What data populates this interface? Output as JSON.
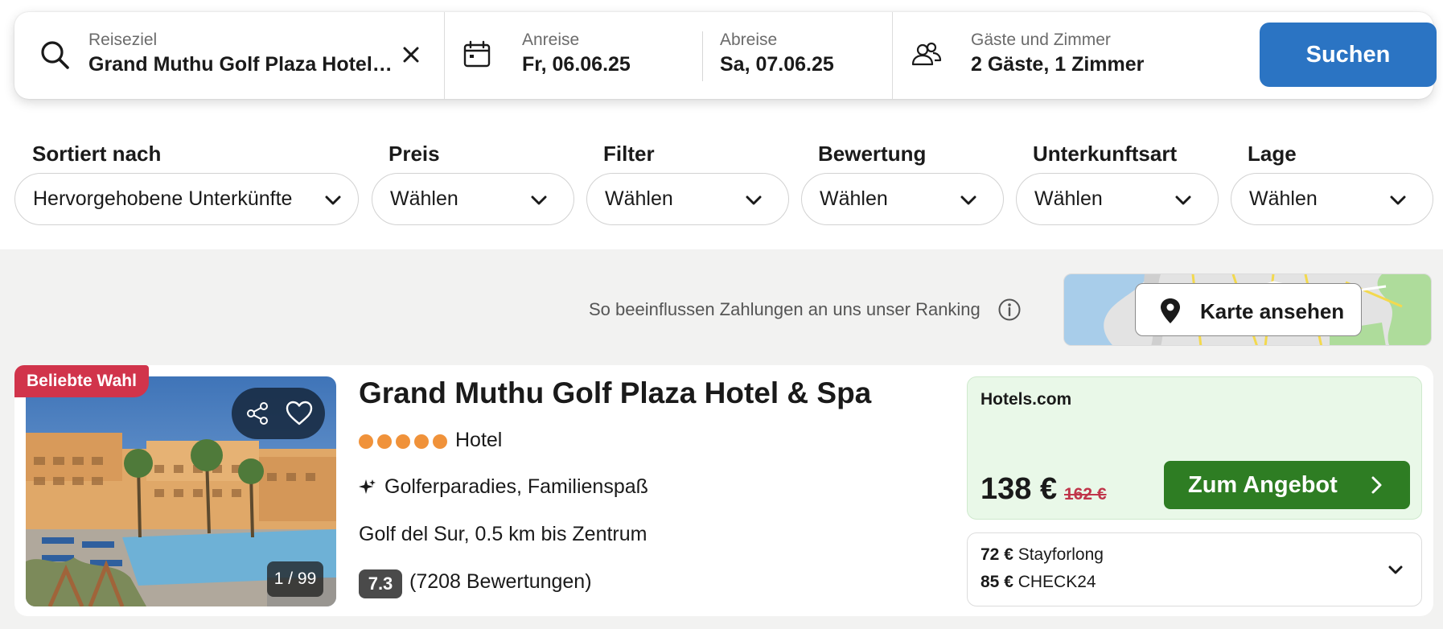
{
  "search": {
    "destination_label": "Reiseziel",
    "destination_value": "Grand Muthu Golf Plaza Hotel & Spa",
    "checkin_label": "Anreise",
    "checkin_value": "Fr, 06.06.25",
    "checkout_label": "Abreise",
    "checkout_value": "Sa, 07.06.25",
    "guests_label": "Gäste und Zimmer",
    "guests_value": "2 Gäste, 1 Zimmer",
    "search_button": "Suchen"
  },
  "filters": [
    {
      "label": "Sortiert nach",
      "value": "Hervorgehobene Unterkünfte"
    },
    {
      "label": "Preis",
      "value": "Wählen"
    },
    {
      "label": "Filter",
      "value": "Wählen"
    },
    {
      "label": "Bewertung",
      "value": "Wählen"
    },
    {
      "label": "Unterkunftsart",
      "value": "Wählen"
    },
    {
      "label": "Lage",
      "value": "Wählen"
    }
  ],
  "ranking_note": "So beeinflussen Zahlungen an uns unser Ranking",
  "map_button": "Karte ansehen",
  "result": {
    "badge": "Beliebte Wahl",
    "photo_counter": "1 / 99",
    "name": "Grand Muthu Golf Plaza Hotel & Spa",
    "stars": 5,
    "type": "Hotel",
    "highlights": "Golferparadies, Familienspaß",
    "location": "Golf del Sur, 0.5 km bis Zentrum",
    "rating": "7.3",
    "rating_count": "(7208 Bewertungen)",
    "deal": {
      "provider": "Hotels.com",
      "price": "138 €",
      "old_price": "162 €",
      "button": "Zum Angebot"
    },
    "other_offers": [
      {
        "price": "72 €",
        "provider": "Stayforlong"
      },
      {
        "price": "85 €",
        "provider": "CHECK24"
      }
    ]
  },
  "colors": {
    "accent_blue": "#2b74c3",
    "offer_green": "#2e7d23",
    "badge_red": "#d1344b",
    "star_orange": "#f0923a",
    "deal_bg": "#e9f8e8"
  }
}
